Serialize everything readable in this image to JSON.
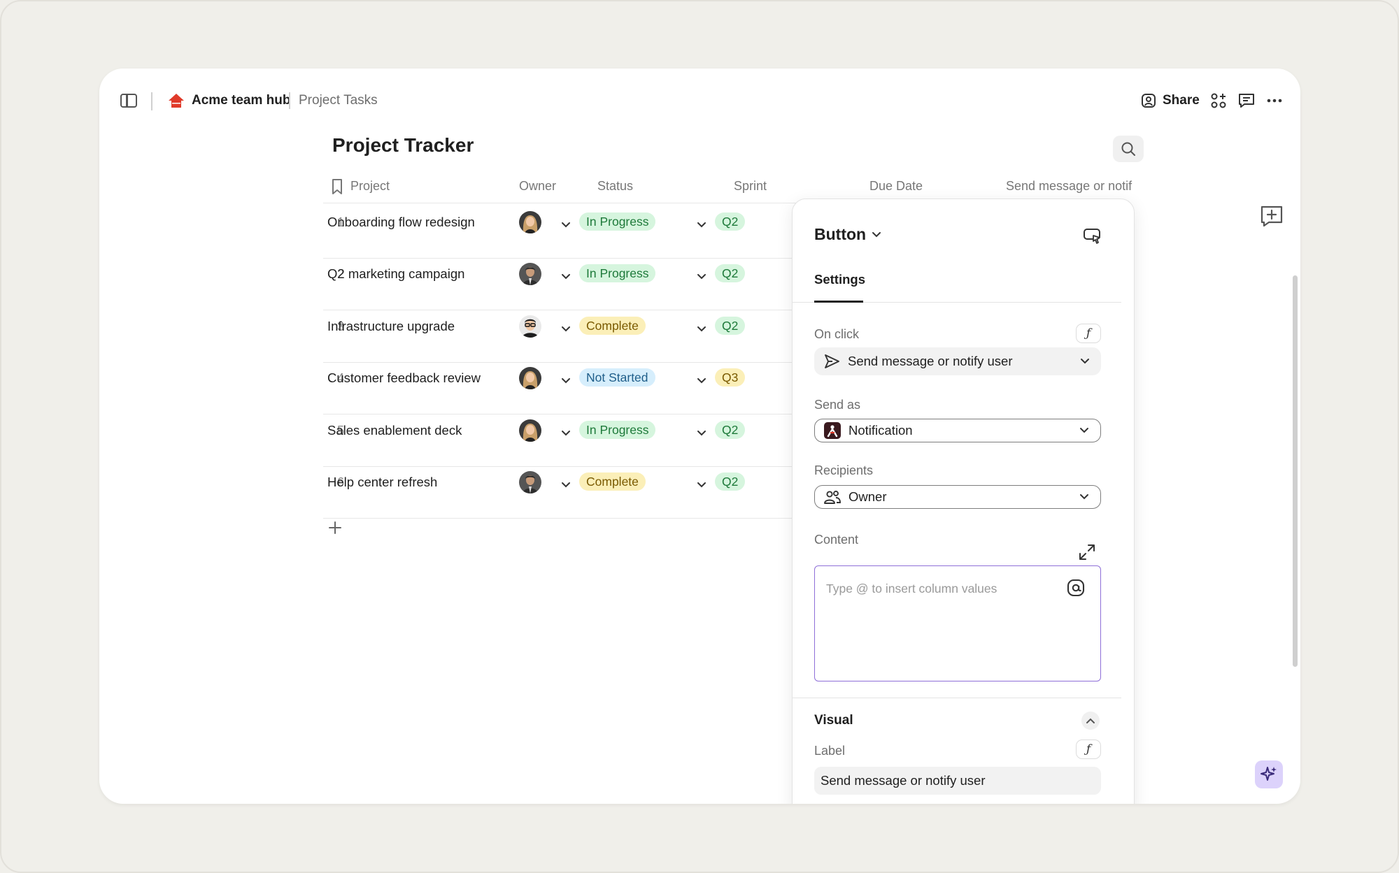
{
  "breadcrumb": {
    "hub": "Acme team hub",
    "page": "Project Tasks"
  },
  "toolbar": {
    "share_label": "Share"
  },
  "page_title": "Project Tracker",
  "table": {
    "columns": [
      "Project",
      "Owner",
      "Status",
      "Sprint",
      "Due Date",
      "Send message or notif"
    ],
    "rows": [
      {
        "num": "1",
        "name": "Onboarding flow redesign",
        "status": "In Progress",
        "status_type": "progress",
        "sprint": "Q2",
        "avatar": "woman-blonde"
      },
      {
        "num": "2",
        "name": "Q2 marketing campaign",
        "status": "In Progress",
        "status_type": "progress",
        "sprint": "Q2",
        "avatar": "man-dark"
      },
      {
        "num": "3",
        "name": "Infrastructure upgrade",
        "status": "Complete",
        "status_type": "complete",
        "sprint": "Q2",
        "avatar": "man-glasses"
      },
      {
        "num": "4",
        "name": "Customer feedback review",
        "status": "Not Started",
        "status_type": "notstarted",
        "sprint": "Q3",
        "avatar": "woman-blonde"
      },
      {
        "num": "5",
        "name": "Sales enablement deck",
        "status": "In Progress",
        "status_type": "progress",
        "sprint": "Q2",
        "avatar": "woman-blonde"
      },
      {
        "num": "6",
        "name": "Help center refresh",
        "status": "Complete",
        "status_type": "complete",
        "sprint": "Q2",
        "avatar": "man-dark"
      }
    ]
  },
  "colors": {
    "progress_bg": "#d6f5de",
    "progress_fg": "#1e7a3a",
    "complete_bg": "#fbefb8",
    "complete_fg": "#7a5a00",
    "notstarted_bg": "#d6eefc",
    "notstarted_fg": "#1f5e8a",
    "q2_bg": "#d6f5de",
    "q2_fg": "#1e7a3a",
    "q3_bg": "#fbefb8",
    "q3_fg": "#7a5a00",
    "accent": "#8f6fd8"
  },
  "panel": {
    "title": "Button",
    "tab": "Settings",
    "on_click_label": "On click",
    "on_click_value": "Send message or notify user",
    "send_as_label": "Send as",
    "send_as_value": "Notification",
    "recipients_label": "Recipients",
    "recipients_value": "Owner",
    "content_label": "Content",
    "content_placeholder": "Type @ to insert column values",
    "visual_title": "Visual",
    "label_label": "Label",
    "label_value": "Send message or notify user"
  },
  "icons": [
    "sidebar-toggle-icon",
    "home-icon",
    "person-icon",
    "apps-icon",
    "comment-icon",
    "more-icon",
    "search-icon",
    "bookmark-icon",
    "chevron-down-icon",
    "plus-icon",
    "comment-add-icon",
    "sparkle-icon",
    "screen-cursor-icon",
    "send-icon",
    "app-logo-icon",
    "people-icon",
    "expand-icon",
    "at-icon",
    "chevron-up-icon",
    "function-icon"
  ]
}
